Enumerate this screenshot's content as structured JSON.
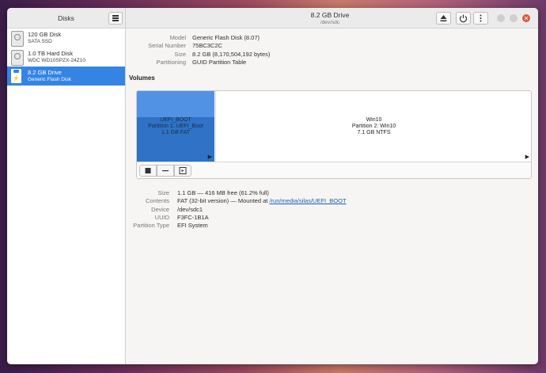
{
  "sidebar": {
    "title": "Disks",
    "disks": [
      {
        "name": "120 GB Disk",
        "sub": "SATA SSD"
      },
      {
        "name": "1.0 TB Hard Disk",
        "sub": "WDC WD10SPZX-24Z10"
      },
      {
        "name": "8.2 GB Drive",
        "sub": "Generic Flash Disk"
      }
    ]
  },
  "header": {
    "title": "8.2 GB Drive",
    "subtitle": "/dev/sdc"
  },
  "drive": {
    "model_label": "Model",
    "model": "Generic Flash Disk (8.07)",
    "serial_label": "Serial Number",
    "serial": "75BC3C2C",
    "size_label": "Size",
    "size": "8.2 GB (8,170,504,192 bytes)",
    "partitioning_label": "Partitioning",
    "partitioning": "GUID Partition Table"
  },
  "volumes": {
    "title": "Volumes",
    "partitions": [
      {
        "name": "UEFI_BOOT",
        "label": "Partition 1: UEFI_Boot",
        "info": "1.1 GB FAT"
      },
      {
        "name": "Win10",
        "label": "Partition 2: Win10",
        "info": "7.1 GB NTFS"
      }
    ]
  },
  "details": {
    "size_label": "Size",
    "size": "1.1 GB — 416 MB free (61.2% full)",
    "contents_label": "Contents",
    "contents_prefix": "FAT (32-bit version) — Mounted at ",
    "contents_link": "/run/media/silas/UEFI_BOOT",
    "device_label": "Device",
    "device": "/dev/sdc1",
    "uuid_label": "UUID",
    "uuid": "F3FC-1B1A",
    "ptype_label": "Partition Type",
    "ptype": "EFI System"
  },
  "colors": {
    "accent": "#3584e4",
    "close": "#e0583c"
  }
}
